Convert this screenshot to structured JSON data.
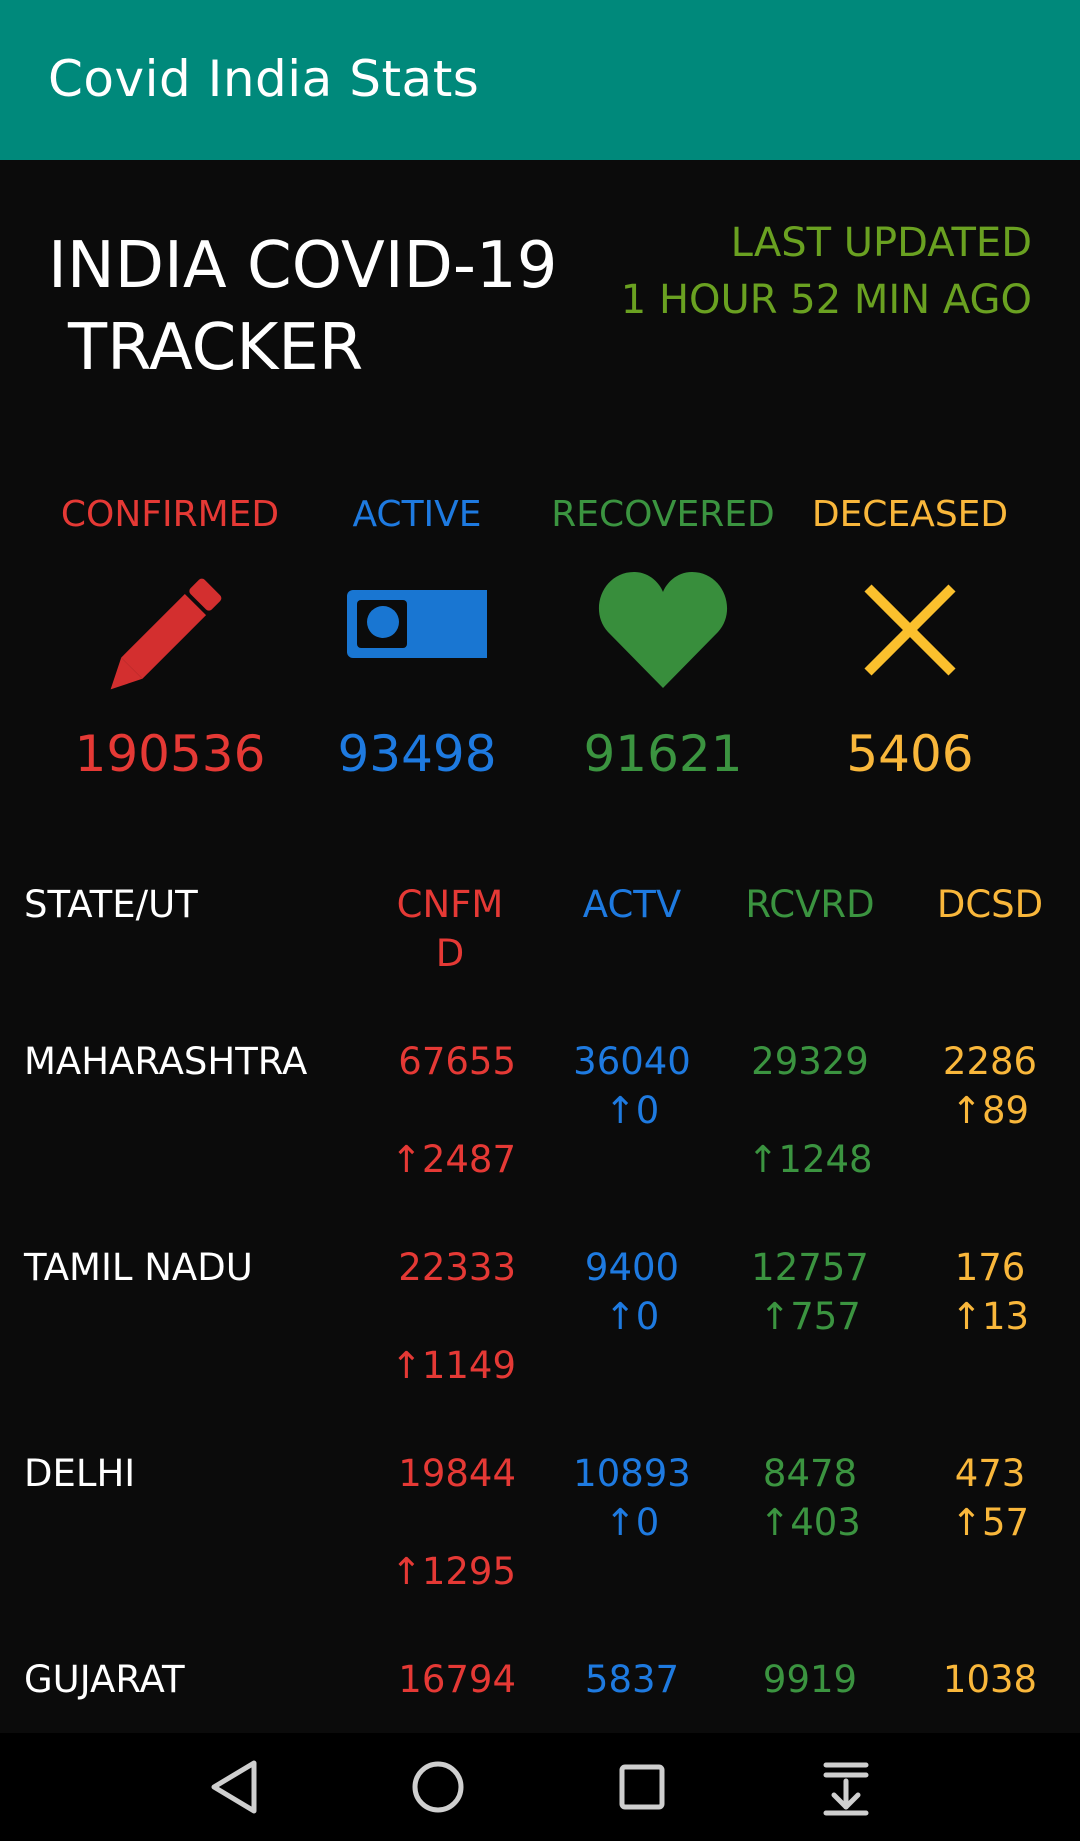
{
  "app": {
    "title": "Covid India Stats"
  },
  "header": {
    "title_line1": "INDIA COVID-19",
    "title_line2": "TRACKER",
    "updated_line1": "LAST UPDATED",
    "updated_line2": "1 HOUR 52 MIN AGO"
  },
  "summary": {
    "confirmed": {
      "label": "CONFIRMED",
      "value": "190536",
      "icon": "pencil-icon",
      "color": "#e53935"
    },
    "active": {
      "label": "ACTIVE",
      "value": "93498",
      "icon": "bed-icon",
      "color": "#1e7ae0"
    },
    "recovered": {
      "label": "RECOVERED",
      "value": "91621",
      "icon": "heart-icon",
      "color": "#3b9440"
    },
    "deceased": {
      "label": "DECEASED",
      "value": "5406",
      "icon": "close-icon",
      "color": "#f9b73b"
    }
  },
  "table": {
    "headers": {
      "state": "STATE/UT",
      "confirmed_line1": "CNFM",
      "confirmed_line2": "D",
      "active": "ACTV",
      "recovered": "RCVRD",
      "deceased": "DCSD"
    },
    "rows": [
      {
        "state": "MAHARASHTRA",
        "confirmed": "67655",
        "confirmed_delta": "↑2487",
        "active": "36040",
        "active_delta": "↑0",
        "recovered": "29329",
        "recovered_delta": "↑1248",
        "deceased": "2286",
        "deceased_delta": "↑89"
      },
      {
        "state": "TAMIL NADU",
        "confirmed": "22333",
        "confirmed_delta": "↑1149",
        "active": "9400",
        "active_delta": "↑0",
        "recovered": "12757",
        "recovered_delta": "↑757",
        "deceased": "176",
        "deceased_delta": "↑13"
      },
      {
        "state": "DELHI",
        "confirmed": "19844",
        "confirmed_delta": "↑1295",
        "active": "10893",
        "active_delta": "↑0",
        "recovered": "8478",
        "recovered_delta": "↑403",
        "deceased": "473",
        "deceased_delta": "↑57"
      },
      {
        "state": "GUJARAT",
        "confirmed": "16794",
        "active": "5837",
        "recovered": "9919",
        "deceased": "1038"
      }
    ]
  },
  "navbar": {
    "back_icon": "back-triangle-icon",
    "home_icon": "home-circle-icon",
    "recents_icon": "recents-square-icon",
    "notifications_icon": "notification-pull-down-icon"
  }
}
